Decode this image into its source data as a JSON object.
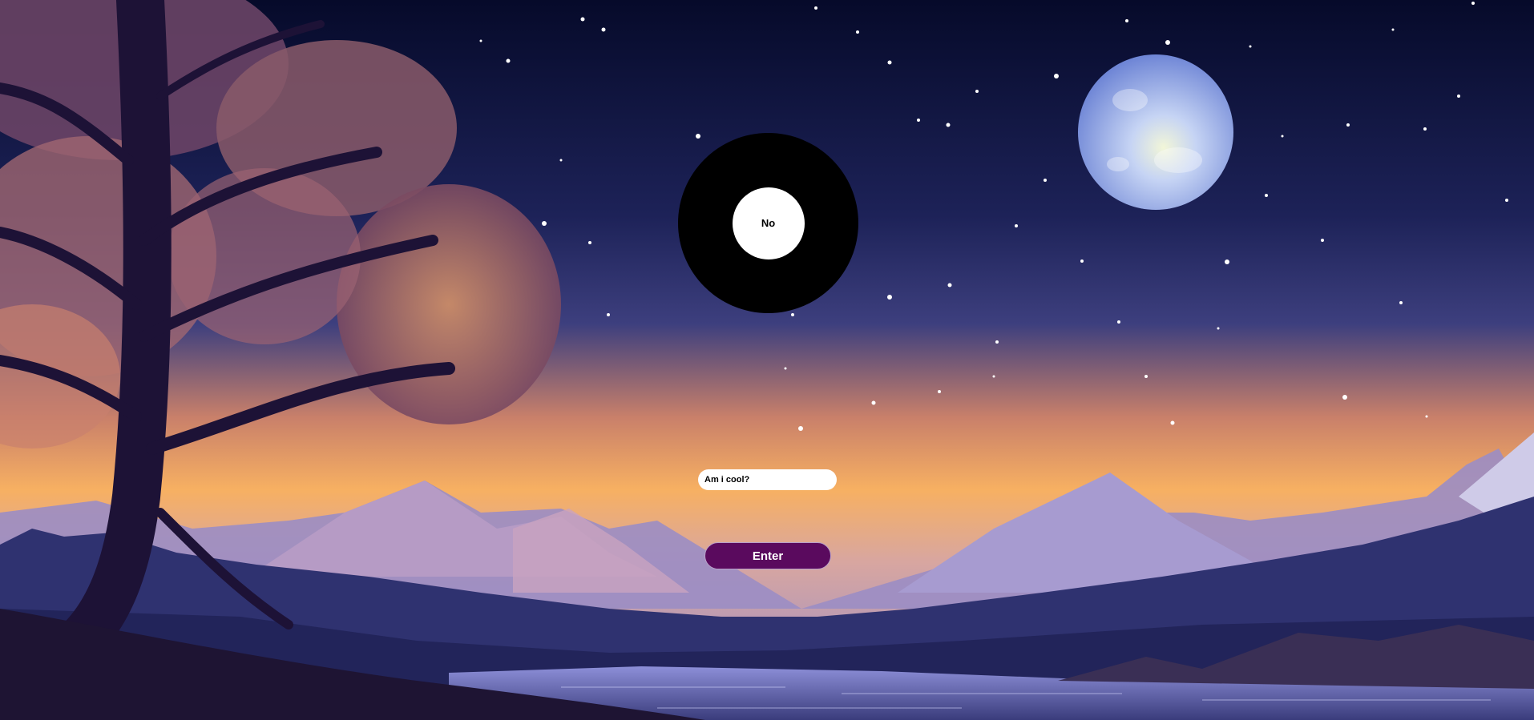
{
  "eight_ball": {
    "answer": "No"
  },
  "question": {
    "value": "Am i cool?"
  },
  "enter_button": {
    "label": "Enter"
  },
  "colors": {
    "sky_top": "#0b1236",
    "sky_mid": "#2a2f6b",
    "horizon": "#f4a55a",
    "mountain": "#8f86c9",
    "water": "#5d62a6",
    "button": "#5a0a5e",
    "moon": "#9fb4f0"
  }
}
